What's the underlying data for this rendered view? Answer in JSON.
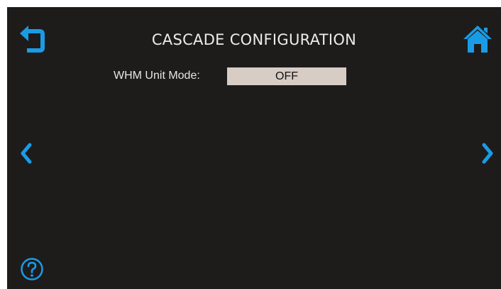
{
  "header": {
    "title": "CASCADE CONFIGURATION"
  },
  "icons": {
    "back": "back-arrow-icon",
    "home": "home-icon",
    "prev": "chevron-left-icon",
    "next": "chevron-right-icon",
    "help": "question-circle-icon"
  },
  "settings": {
    "whm_unit_mode": {
      "label": "WHM Unit Mode:",
      "value": "OFF"
    }
  },
  "colors": {
    "accent": "#1a9be6",
    "background": "#1e1b1b",
    "value_field": "#d8cdc5"
  }
}
